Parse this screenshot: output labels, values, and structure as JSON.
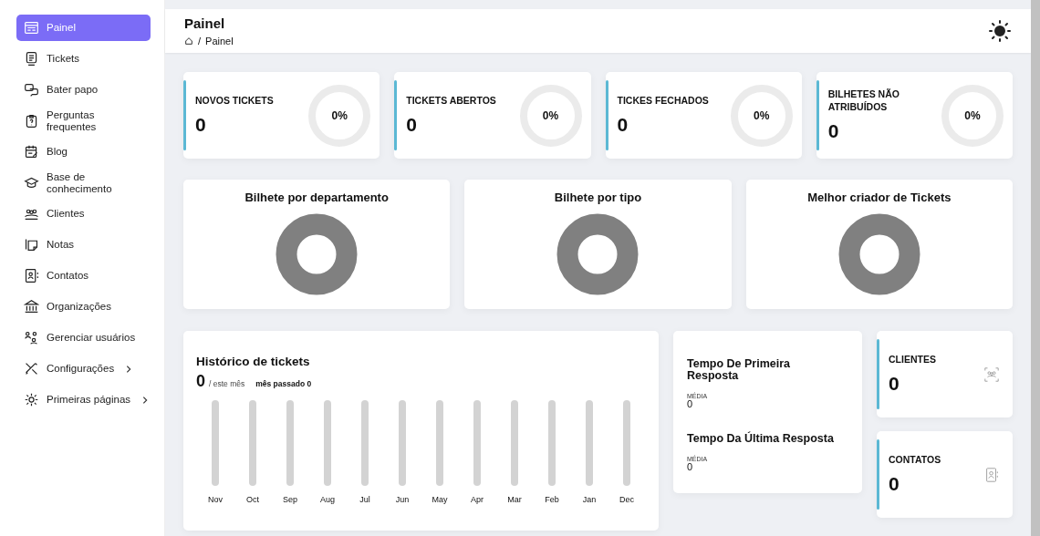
{
  "sidebar": {
    "items": [
      {
        "label": "Painel",
        "selected": true,
        "submenu": false
      },
      {
        "label": "Tickets",
        "selected": false,
        "submenu": false
      },
      {
        "label": "Bater papo",
        "selected": false,
        "submenu": false
      },
      {
        "label": "Perguntas frequentes",
        "selected": false,
        "submenu": false
      },
      {
        "label": "Blog",
        "selected": false,
        "submenu": false
      },
      {
        "label": "Base de conhecimento",
        "selected": false,
        "submenu": false
      },
      {
        "label": "Clientes",
        "selected": false,
        "submenu": false
      },
      {
        "label": "Notas",
        "selected": false,
        "submenu": false
      },
      {
        "label": "Contatos",
        "selected": false,
        "submenu": false
      },
      {
        "label": "Organizações",
        "selected": false,
        "submenu": false
      },
      {
        "label": "Gerenciar usuários",
        "selected": false,
        "submenu": false
      },
      {
        "label": "Configurações",
        "selected": false,
        "submenu": true
      },
      {
        "label": "Primeiras páginas",
        "selected": false,
        "submenu": true
      }
    ]
  },
  "header": {
    "title": "Painel",
    "separator": "/",
    "breadcrumb": [
      "Painel"
    ]
  },
  "stats": [
    {
      "label": "NOVOS TICKETS",
      "value": "0",
      "percent": "0%"
    },
    {
      "label": "TICKETS ABERTOS",
      "value": "0",
      "percent": "0%"
    },
    {
      "label": "TICKES FECHADOS",
      "value": "0",
      "percent": "0%"
    },
    {
      "label": "BILHETES NÃO ATRIBUÍDOS",
      "value": "0",
      "percent": "0%"
    }
  ],
  "charts": [
    {
      "title": "Bilhete por departamento"
    },
    {
      "title": "Bilhete por tipo"
    },
    {
      "title": "Melhor criador de Tickets"
    }
  ],
  "history": {
    "title": "Histórico de tickets",
    "count": "0",
    "period": "/ este mês",
    "previous": "mês passado 0",
    "months": [
      "Nov",
      "Oct",
      "Sep",
      "Aug",
      "Jul",
      "Jun",
      "May",
      "Apr",
      "Mar",
      "Feb",
      "Jan",
      "Dec"
    ]
  },
  "response_times": [
    {
      "title": "Tempo De Primeira Resposta",
      "caption": "MÉDIA",
      "value": "0"
    },
    {
      "title": "Tempo Da Última Resposta",
      "caption": "MÉDIA",
      "value": "0"
    }
  ],
  "counters": [
    {
      "label": "CLIENTES",
      "value": "0"
    },
    {
      "label": "CONTATOS",
      "value": "0"
    }
  ]
}
